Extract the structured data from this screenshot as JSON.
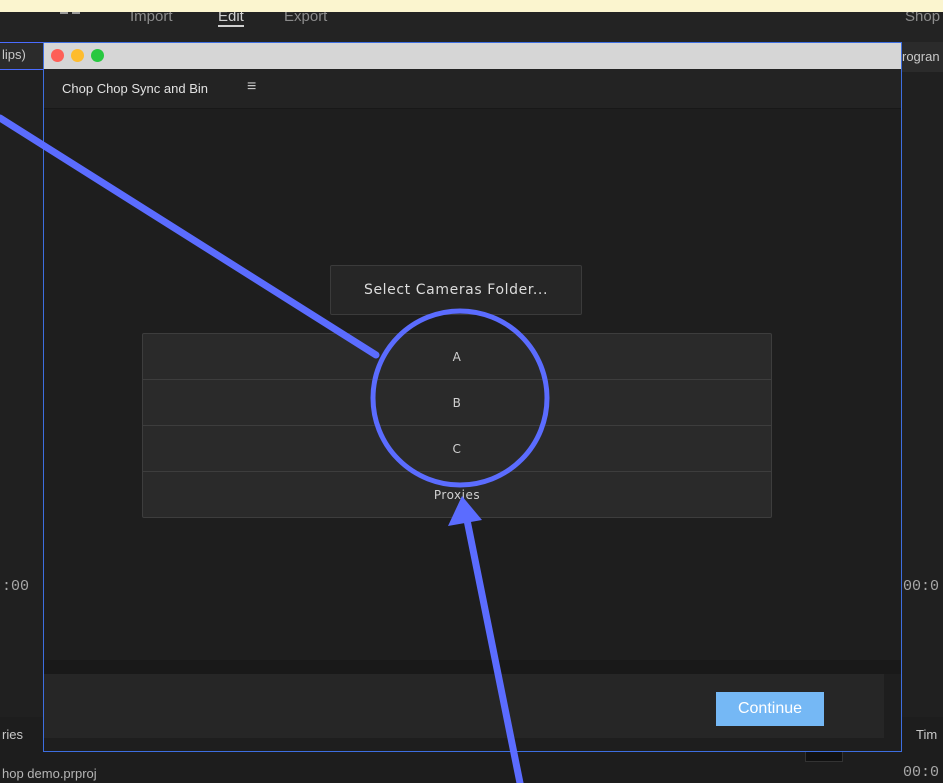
{
  "background_app": {
    "menu": [
      "Import",
      "Edit",
      "Export"
    ],
    "active_menu": "Edit",
    "right_menu": "Shop",
    "left_panel_tab": "lips)",
    "right_panel_tab": "rogran",
    "left_timecode": ":00",
    "right_timecode": "00:0",
    "left_bottom_label": "ries",
    "right_bottom_label": "Tim",
    "project_file": "hop demo.prproj",
    "right_bottom_timecode": "00:0"
  },
  "plugin_window": {
    "panel_title": "Chop Chop Sync and Bin",
    "panel_menu_icon": "≡",
    "select_folder_label": "Select Cameras Folder...",
    "folders": [
      "A",
      "B",
      "C",
      "Proxies"
    ],
    "continue_label": "Continue"
  },
  "icons": {
    "workspace": "workspaces-grid-icon",
    "panel_menu": "hamburger-menu-icon",
    "flag": "flag-icon"
  },
  "colors": {
    "annotation": "#5b6cff",
    "continue_button": "#75b8f5",
    "window_border": "#3d6ee0",
    "backdrop": "#fbf5cf"
  }
}
